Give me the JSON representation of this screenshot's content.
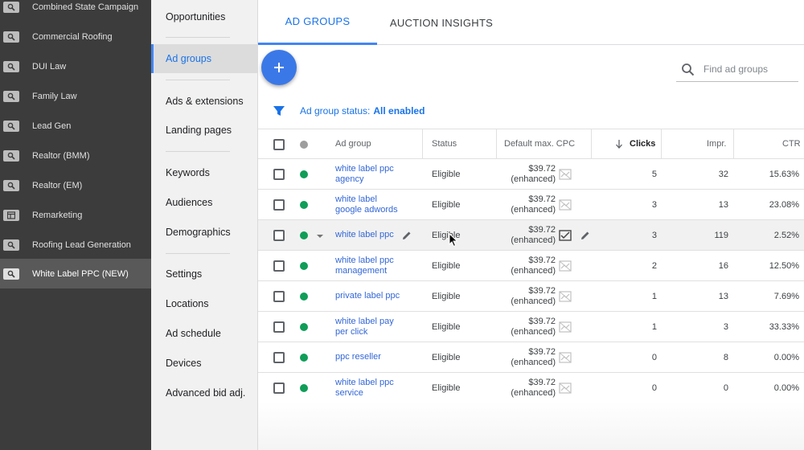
{
  "campaigns": [
    {
      "label": "Combined State Campaign",
      "icon": "search-campaign-icon"
    },
    {
      "label": "Commercial Roofing",
      "icon": "search-campaign-icon"
    },
    {
      "label": "DUI Law",
      "icon": "search-campaign-icon"
    },
    {
      "label": "Family Law",
      "icon": "search-campaign-icon"
    },
    {
      "label": "Lead Gen",
      "icon": "search-campaign-icon"
    },
    {
      "label": "Realtor (BMM)",
      "icon": "search-campaign-icon"
    },
    {
      "label": "Realtor (EM)",
      "icon": "search-campaign-icon"
    },
    {
      "label": "Remarketing",
      "icon": "display-campaign-icon"
    },
    {
      "label": "Roofing Lead Generation",
      "icon": "search-campaign-icon"
    },
    {
      "label": "White Label PPC (NEW)",
      "icon": "search-campaign-icon",
      "active": true
    }
  ],
  "nav": [
    {
      "label": "Opportunities"
    },
    {
      "label": "Ad groups",
      "active": true
    },
    {
      "label": "Ads & extensions"
    },
    {
      "label": "Landing pages"
    },
    {
      "label": "Keywords"
    },
    {
      "label": "Audiences"
    },
    {
      "label": "Demographics"
    },
    {
      "label": "Settings"
    },
    {
      "label": "Locations"
    },
    {
      "label": "Ad schedule"
    },
    {
      "label": "Devices"
    },
    {
      "label": "Advanced bid adj."
    }
  ],
  "tabs": {
    "ad_groups": "AD GROUPS",
    "auction_insights": "AUCTION INSIGHTS"
  },
  "search": {
    "placeholder": "Find ad groups"
  },
  "filter": {
    "label": "Ad group status:",
    "value": "All enabled"
  },
  "table": {
    "headers": {
      "ad_group": "Ad group",
      "status": "Status",
      "cpc": "Default max. CPC",
      "clicks": "Clicks",
      "impr": "Impr.",
      "ctr": "CTR"
    },
    "sort": {
      "column": "clicks",
      "direction": "descending"
    },
    "rows": [
      {
        "name_1": "white label ppc",
        "name_2": "agency",
        "status": "Eligible",
        "cpc": "$39.72",
        "cpc_note": "(enhanced)",
        "clicks": "5",
        "impr": "32",
        "ctr": "15.63%"
      },
      {
        "name_1": "white label",
        "name_2": "google adwords",
        "status": "Eligible",
        "cpc": "$39.72",
        "cpc_note": "(enhanced)",
        "clicks": "3",
        "impr": "13",
        "ctr": "23.08%"
      },
      {
        "name_1": "white label ppc",
        "name_2": "",
        "status": "Eligible",
        "cpc": "$39.72",
        "cpc_note": "(enhanced)",
        "clicks": "3",
        "impr": "119",
        "ctr": "2.52%"
      },
      {
        "name_1": "white label ppc",
        "name_2": "management",
        "status": "Eligible",
        "cpc": "$39.72",
        "cpc_note": "(enhanced)",
        "clicks": "2",
        "impr": "16",
        "ctr": "12.50%"
      },
      {
        "name_1": "private label ppc",
        "name_2": "",
        "status": "Eligible",
        "cpc": "$39.72",
        "cpc_note": "(enhanced)",
        "clicks": "1",
        "impr": "13",
        "ctr": "7.69%"
      },
      {
        "name_1": "white label pay",
        "name_2": "per click",
        "status": "Eligible",
        "cpc": "$39.72",
        "cpc_note": "(enhanced)",
        "clicks": "1",
        "impr": "3",
        "ctr": "33.33%"
      },
      {
        "name_1": "ppc reseller",
        "name_2": "",
        "status": "Eligible",
        "cpc": "$39.72",
        "cpc_note": "(enhanced)",
        "clicks": "0",
        "impr": "8",
        "ctr": "0.00%"
      },
      {
        "name_1": "white label ppc",
        "name_2": "service",
        "status": "Eligible",
        "cpc": "$39.72",
        "cpc_note": "(enhanced)",
        "clicks": "0",
        "impr": "0",
        "ctr": "0.00%"
      }
    ]
  },
  "colors": {
    "sidebar_bg": "#3c3c3c",
    "sidebar_active": "#595959",
    "accent_blue": "#4285f4",
    "link_blue": "#3367d6",
    "enabled_green": "#0f9d58",
    "fab_blue": "#3b78e7"
  }
}
